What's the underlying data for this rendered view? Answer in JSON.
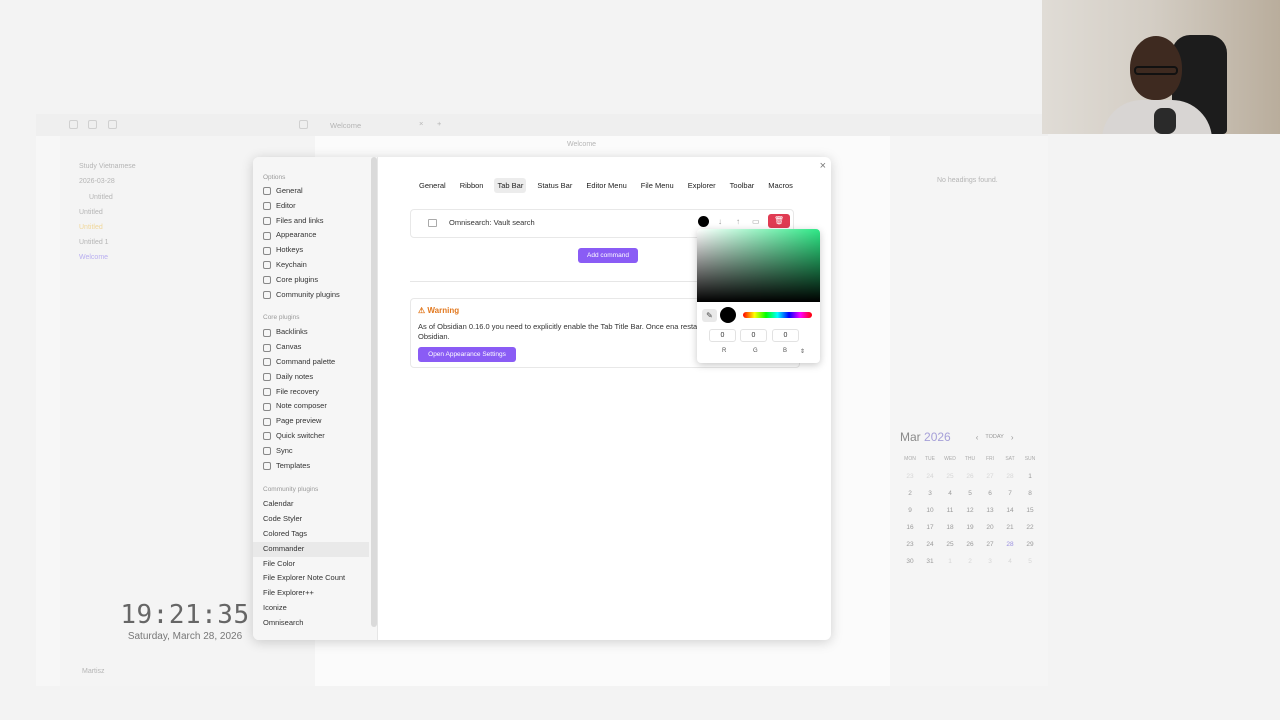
{
  "app": {
    "tab_title": "Welcome",
    "tab_add": "+",
    "tab_close": "×",
    "header_title": "Welcome",
    "explorer": [
      "2026-03-28",
      "Untitled",
      "Untitled",
      "Untitled",
      "Untitled 1",
      "Welcome"
    ],
    "explorer_folder": "Study Vietnamese",
    "outline_empty": "No headings found.",
    "user": "Martisz"
  },
  "clock": {
    "time": "19:21:35",
    "date": "Saturday, March 28, 2026"
  },
  "calendar": {
    "month": "Mar",
    "year": "2026",
    "today_label": "TODAY",
    "days": [
      "MON",
      "TUE",
      "WED",
      "THU",
      "FRI",
      "SAT",
      "SUN"
    ],
    "weeks": [
      [
        "23",
        "24",
        "25",
        "26",
        "27",
        "28",
        "1"
      ],
      [
        "2",
        "3",
        "4",
        "5",
        "6",
        "7",
        "8"
      ],
      [
        "9",
        "10",
        "11",
        "12",
        "13",
        "14",
        "15"
      ],
      [
        "16",
        "17",
        "18",
        "19",
        "20",
        "21",
        "22"
      ],
      [
        "23",
        "24",
        "25",
        "26",
        "27",
        "28",
        "29"
      ],
      [
        "30",
        "31",
        "1",
        "2",
        "3",
        "4",
        "5"
      ]
    ]
  },
  "settings": {
    "options_header": "Options",
    "options": [
      "General",
      "Editor",
      "Files and links",
      "Appearance",
      "Hotkeys",
      "Keychain",
      "Core plugins",
      "Community plugins"
    ],
    "core_header": "Core plugins",
    "core": [
      "Backlinks",
      "Canvas",
      "Command palette",
      "Daily notes",
      "File recovery",
      "Note composer",
      "Page preview",
      "Quick switcher",
      "Sync",
      "Templates"
    ],
    "community_header": "Community plugins",
    "community": [
      "Calendar",
      "Code Styler",
      "Colored Tags",
      "Commander",
      "File Color",
      "File Explorer Note Count",
      "File Explorer++",
      "Iconize",
      "Omnisearch"
    ],
    "close": "×"
  },
  "commander": {
    "tabs": [
      "General",
      "Ribbon",
      "Tab Bar",
      "Status Bar",
      "Editor Menu",
      "File Menu",
      "Explorer",
      "Toolbar",
      "Macros"
    ],
    "command_label": "Omnisearch: Vault search",
    "add_command": "Add command",
    "warning_title": "Warning",
    "warning_body": "As of Obsidian 0.16.0 you need to explicitly enable the Tab Title Bar. Once ena restart Obsidian.",
    "open_appearance": "Open Appearance Settings"
  },
  "picker": {
    "r": "0",
    "g": "0",
    "b": "0",
    "r_label": "R",
    "g_label": "G",
    "b_label": "B",
    "mode_toggle": "⇕",
    "selected_color": "#000000"
  },
  "colors": {
    "accent": "#8a5cf5",
    "danger": "#e03b52",
    "warning": "#e2781e"
  }
}
